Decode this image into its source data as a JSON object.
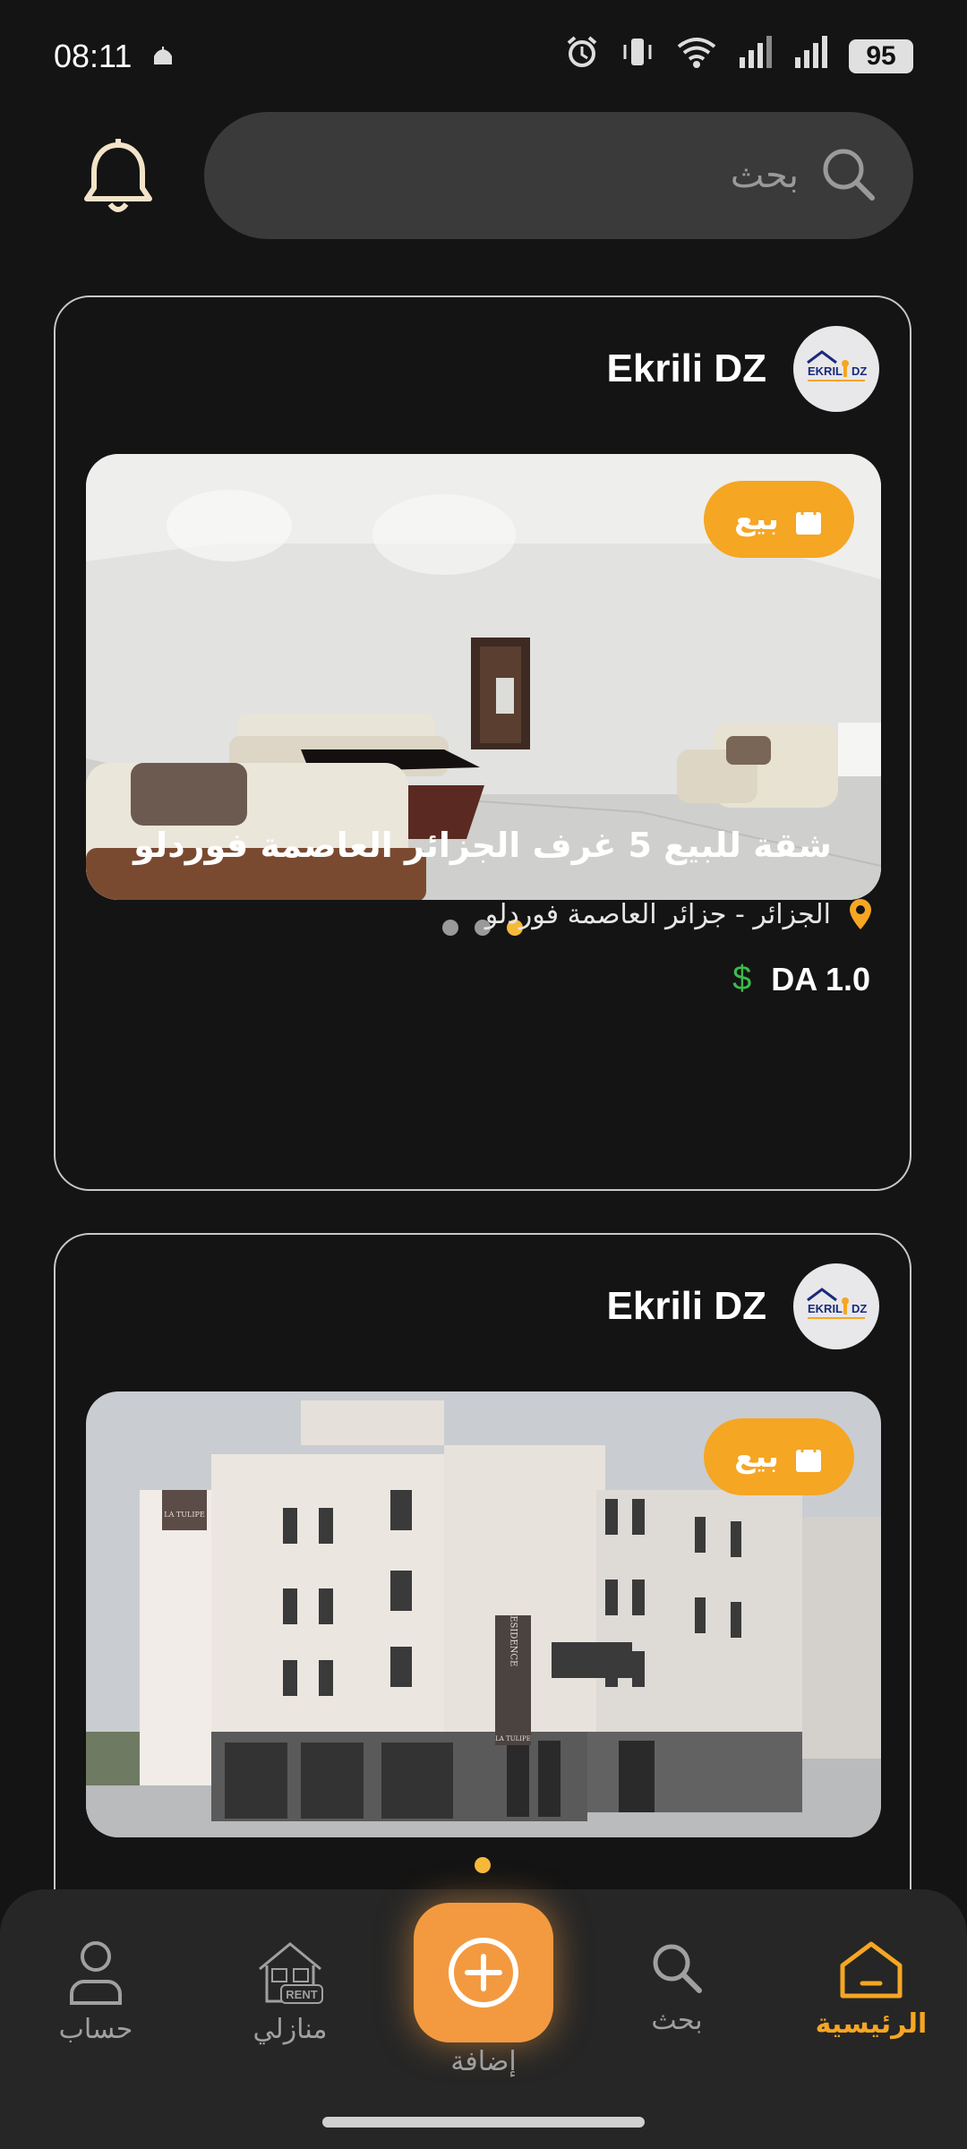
{
  "status_bar": {
    "time": "08:11",
    "battery": "95"
  },
  "search": {
    "placeholder": "بحث"
  },
  "listings": [
    {
      "publisher": "Ekrili DZ",
      "badge": "بيع",
      "title": "شقة للبيع 5 غرف الجزائر العاصمة فوردلو",
      "location": "الجزائر - جزائر العاصمة فوردلو",
      "price": "DA 1.0",
      "currency_symbol": "$",
      "photo_count": 3,
      "active_photo": 3
    },
    {
      "publisher": "Ekrili DZ",
      "badge": "بيع",
      "photo_count": 1,
      "active_photo": 1,
      "building_sign": "RESIDENCE",
      "building_name": "LA TULIPE"
    }
  ],
  "logo_text": {
    "left": "EKRIL",
    "right": "DZ"
  },
  "nav": {
    "account": "حساب",
    "my_homes": "منازلي",
    "add": "إضافة",
    "search": "بحث",
    "home": "الرئيسية",
    "rent_sign": "RENT"
  },
  "colors": {
    "accent": "#f5a623",
    "card_border": "#c8c8c8",
    "price_icon": "#3dbb4a"
  }
}
